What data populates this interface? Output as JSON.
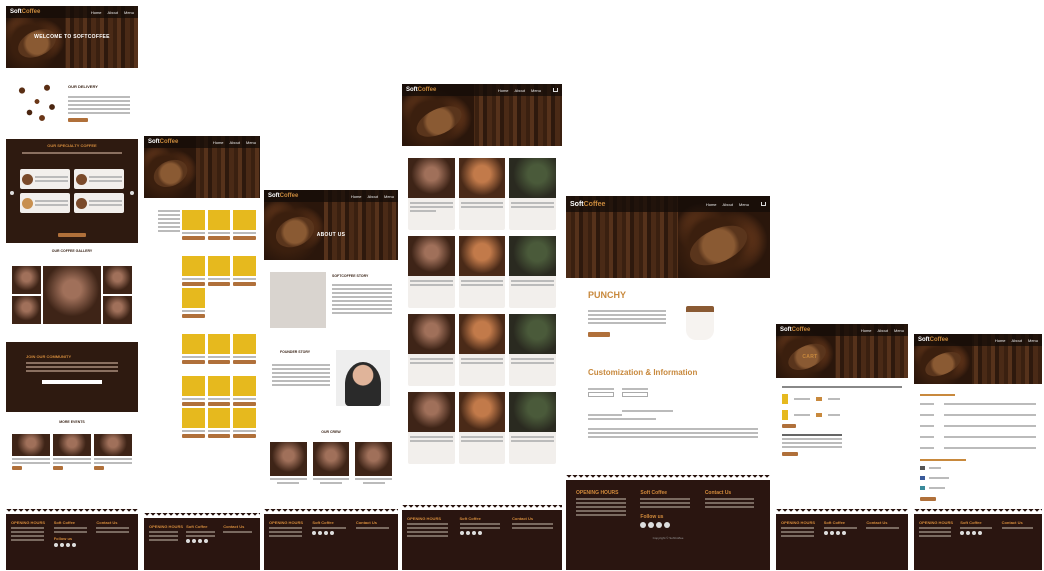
{
  "brand": {
    "name_a": "Soft",
    "name_b": "Coffee"
  },
  "nav": {
    "home": "Home",
    "about": "About",
    "menu": "Menu"
  },
  "pages": {
    "home": {
      "hero_title": "WELCOME TO SOFTCOFFEE",
      "delivery_title": "OUR DELIVERY",
      "specialities_title": "OUR SPECIALTY COFFEE",
      "gallery_title": "OUR COFFEE GALLERY",
      "news_title": "MORE EVENTS",
      "signup_title": "JOIN OUR COMMUNITY"
    },
    "about": {
      "hero_title": "ABOUT US",
      "story_title": "SOFTCOFFEE STORY",
      "founder_title": "FOUNDER STORY",
      "crew_title": "OUR CREW"
    },
    "product": {
      "name": "PUNCHY",
      "section_title": "Customization & Information",
      "hero_label": "CART"
    }
  },
  "footer": {
    "col1": "OPENING HOURS",
    "col2": "Soft Coffee",
    "col3": "Contact Us",
    "follow": "Follow us",
    "copyright": "Copyright © SoftCoffee"
  },
  "colors": {
    "accent": "#c8893d",
    "dark": "#2a1510",
    "button": "#b0703a"
  }
}
